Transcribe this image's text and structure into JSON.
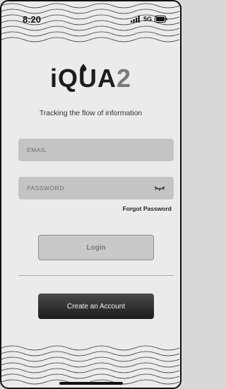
{
  "status_bar": {
    "time": "8:20",
    "network": "5G"
  },
  "logo": {
    "letters_main": "iQUA",
    "letter_suffix": "2",
    "brand_dark": "#1c1c1c",
    "brand_gray": "#7a7a7a"
  },
  "tagline": "Tracking the flow of information",
  "form": {
    "email_placeholder": "EMAIL",
    "password_placeholder": "PASSWORD",
    "password_toggle_icon": "eye-closed-icon",
    "forgot_password_label": "Forgot Password",
    "login_label": "Login"
  },
  "create_account_label": "Create an Account",
  "colors": {
    "background": "#ebebeb",
    "field_background": "#c4c4c4",
    "primary_button": "#2a2a2a",
    "disabled_button": "#c9c9c9"
  }
}
